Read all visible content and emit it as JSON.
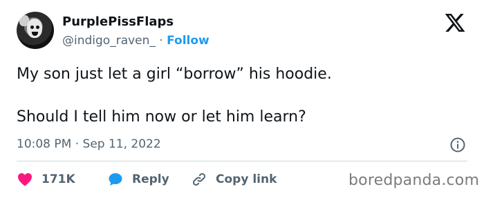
{
  "user": {
    "display_name": "PurplePissFlaps",
    "handle": "@indigo_raven_",
    "separator": "·",
    "follow_label": "Follow"
  },
  "tweet": {
    "line1": "My son just let a girl “borrow” his hoodie.",
    "line2": "Should I tell him now or let him learn?",
    "timestamp": "10:08 PM · Sep 11, 2022"
  },
  "actions": {
    "like_count": "171K",
    "reply_label": "Reply",
    "copy_label": "Copy link"
  },
  "watermark": "boredpanda.com",
  "icons": {
    "logo": "x-logo-icon",
    "info": "info-icon",
    "like": "heart-icon",
    "reply": "speech-bubble-icon",
    "copy": "link-icon"
  },
  "colors": {
    "accent": "#1d9bf0",
    "like": "#f91880",
    "secondary_text": "#536471",
    "primary_text": "#0f1419"
  }
}
